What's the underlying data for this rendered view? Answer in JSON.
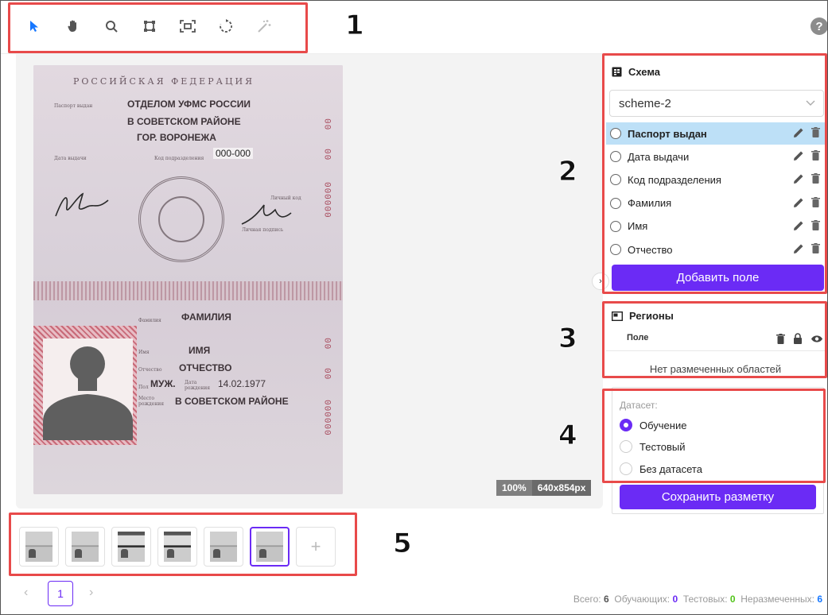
{
  "toolbar": {
    "tools": [
      "pointer-icon",
      "hand-icon",
      "zoom-icon",
      "crop-icon",
      "fit-icon",
      "rotate-icon",
      "magic-wand-icon"
    ],
    "help_label": "?"
  },
  "annotations": [
    "1",
    "2",
    "3",
    "4",
    "5"
  ],
  "document": {
    "header": "РОССИЙСКАЯ   ФЕДЕРАЦИЯ",
    "issued_line1": "ОТДЕЛОМ УФМС РОССИИ",
    "issued_line2": "В СОВЕТСКОМ РАЙОНЕ",
    "issued_line3": "ГОР. ВОРОНЕЖА",
    "code": "000-000",
    "label_issued": "Паспорт выдан",
    "label_date": "Дата выдачи",
    "label_code": "Код подразделения",
    "label_personal_sign": "Личный код",
    "label_owner_sign": "Личная подпись",
    "surname": "ФАМИЛИЯ",
    "name": "ИМЯ",
    "patronymic": "ОТЧЕСТВО",
    "sex": "МУЖ.",
    "birth_date": "14.02.1977",
    "birth_place": "В СОВЕТСКОМ РАЙОНЕ",
    "label_surname": "Фамилия",
    "label_name": "Имя",
    "label_patronymic": "Отчество",
    "label_sex": "Пол",
    "label_birth_date": "Дата рождения",
    "label_birth_place": "Место рождения",
    "serial_top_1": "00",
    "serial_top_2": "00",
    "serial_top_3": "000000",
    "serial_bottom_1": "00",
    "serial_bottom_2": "00",
    "serial_bottom_3": "000000"
  },
  "canvas": {
    "zoom": "100%",
    "dimensions": "640x854px"
  },
  "schema": {
    "title": "Схема",
    "selected": "scheme-2",
    "fields": [
      {
        "label": "Паспорт выдан",
        "active": true
      },
      {
        "label": "Дата выдачи",
        "active": false
      },
      {
        "label": "Код подразделения",
        "active": false
      },
      {
        "label": "Фамилия",
        "active": false
      },
      {
        "label": "Имя",
        "active": false
      },
      {
        "label": "Отчество",
        "active": false
      }
    ],
    "add_button": "Добавить поле"
  },
  "regions": {
    "title": "Регионы",
    "column": "Поле",
    "empty": "Нет размеченных областей"
  },
  "dataset": {
    "label": "Датасет:",
    "options": [
      "Обучение",
      "Тестовый",
      "Без датасета"
    ],
    "selected": "Обучение"
  },
  "save_button": "Сохранить разметку",
  "thumbnails": {
    "count": 6,
    "selected_index": 5,
    "add_label": "+"
  },
  "pagination": {
    "prev": "‹",
    "page": "1",
    "next": "›"
  },
  "stats": {
    "total_label": "Всего:",
    "total": "6",
    "train_label": "Обучающих:",
    "train": "0",
    "test_label": "Тестовых:",
    "test": "0",
    "unlabeled_label": "Неразмеченных:",
    "unlabeled": "6"
  },
  "colors": {
    "accent": "#6b2bf5",
    "annotation": "#e84a4a",
    "active_row": "#bde0f7"
  }
}
